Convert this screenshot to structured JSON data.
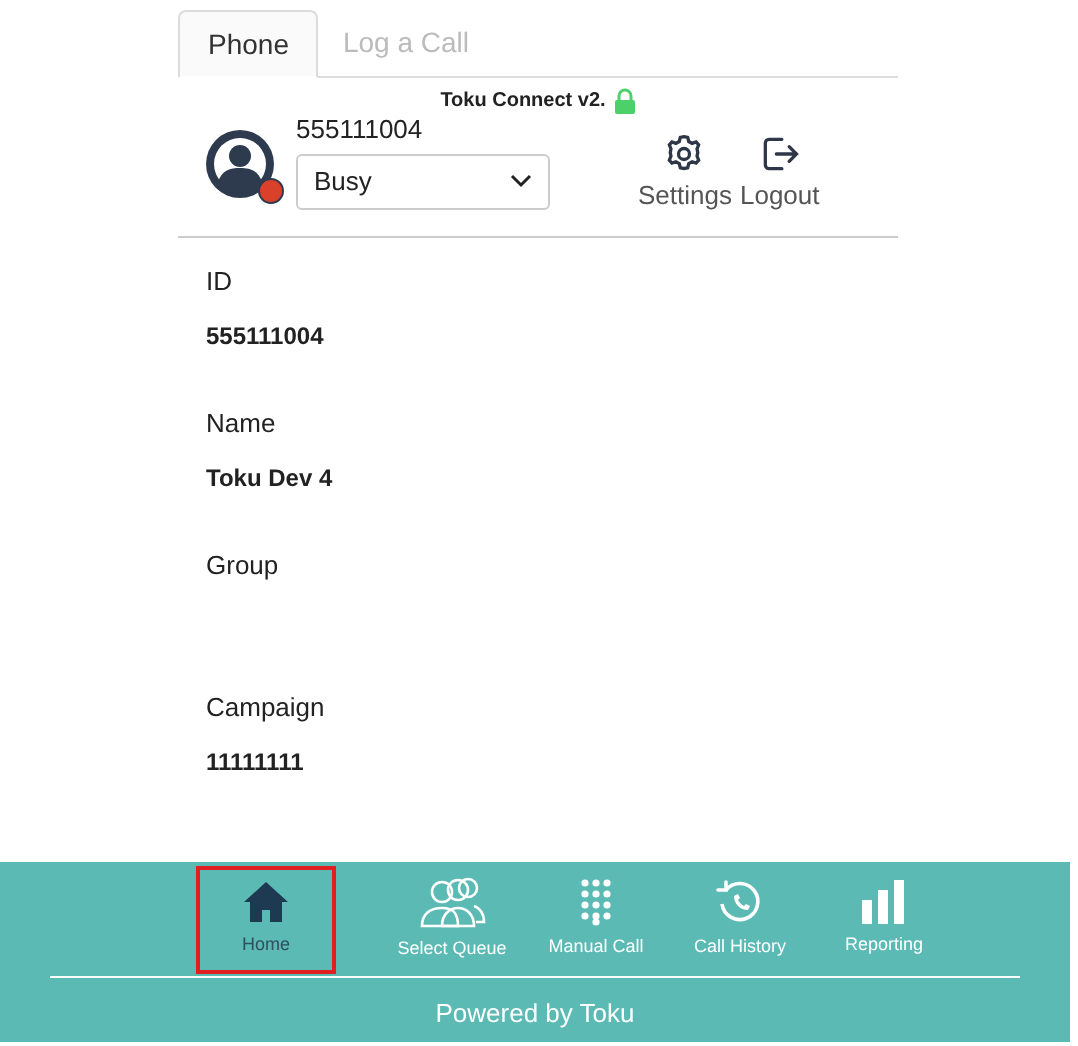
{
  "tabs": [
    {
      "label": "Phone",
      "selected": true
    },
    {
      "label": "Log a Call",
      "selected": false
    }
  ],
  "header": {
    "version": "Toku Connect v2.",
    "locked": true,
    "user_id": "555111004",
    "status": {
      "value": "Busy",
      "color": "#d9412b"
    },
    "actions": [
      {
        "kind": "settings",
        "label": "Settings"
      },
      {
        "kind": "logout",
        "label": "Logout"
      }
    ]
  },
  "fields": [
    {
      "label": "ID",
      "value": "555111004"
    },
    {
      "label": "Name",
      "value": "Toku Dev 4"
    },
    {
      "label": "Group"
    },
    {
      "label": "Campaign",
      "value": "11111111"
    }
  ],
  "nav": [
    {
      "kind": "home",
      "label": "Home",
      "selected": true
    },
    {
      "kind": "queue",
      "label": "Select Queue",
      "selected": false
    },
    {
      "kind": "dialpad",
      "label": "Manual Call",
      "selected": false
    },
    {
      "kind": "history",
      "label": "Call History",
      "selected": false
    },
    {
      "kind": "reporting",
      "label": "Reporting",
      "selected": false
    }
  ],
  "footer": "Powered by Toku"
}
